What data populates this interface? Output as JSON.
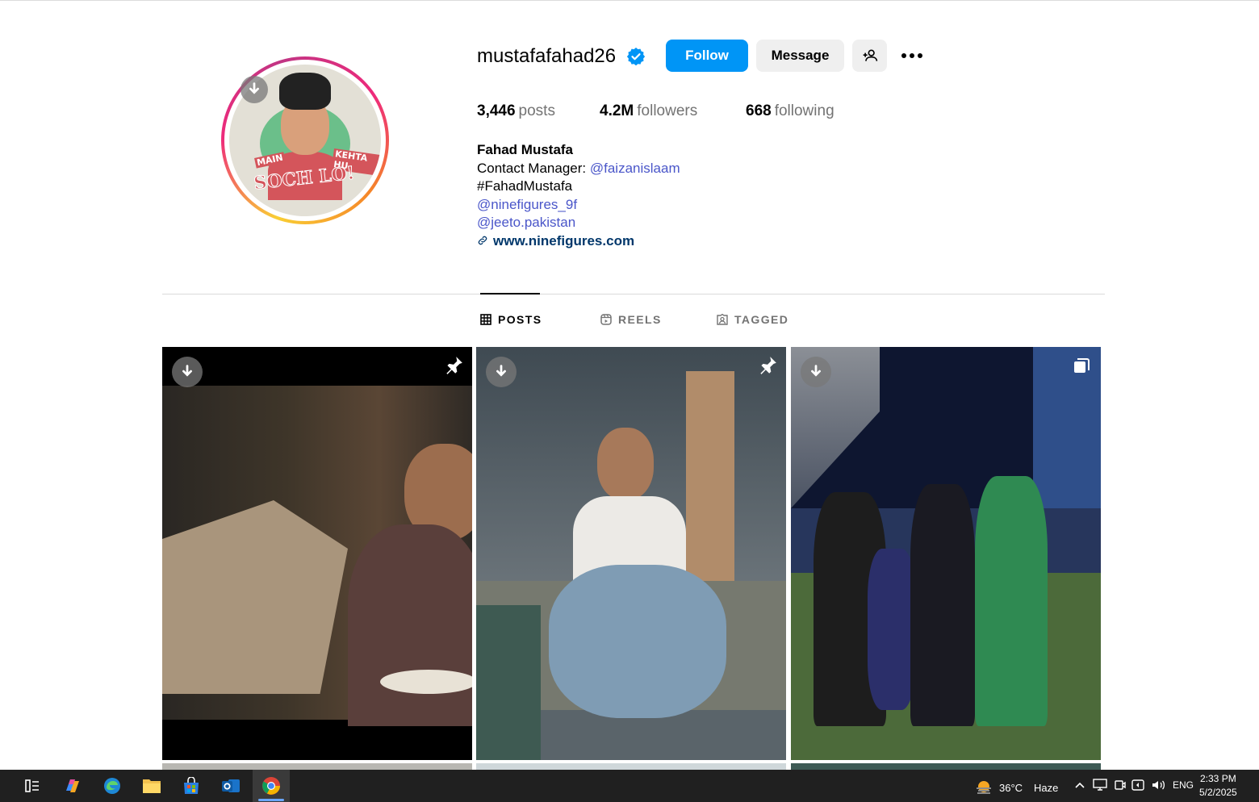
{
  "profile": {
    "username": "mustafafahad26",
    "verified_icon": "verified-badge-icon",
    "buttons": {
      "follow": "Follow",
      "message": "Message"
    },
    "stats": {
      "posts_count": "3,446",
      "posts_label": "posts",
      "followers_count": "4.2M",
      "followers_label": "followers",
      "following_count": "668",
      "following_label": "following"
    },
    "bio": {
      "name": "Fahad Mustafa",
      "contact_prefix": "Contact Manager: ",
      "contact_handle": "@faizanislaam",
      "hashtag": "#FahadMustafa",
      "link1": "@ninefigures_9f",
      "link2": "@jeeto.pakistan",
      "website": "www.ninefigures.com"
    },
    "avatar_caption_main": "SOCH LO!",
    "avatar_caption_left": "MAIN",
    "avatar_caption_right": "KEHTA HU"
  },
  "tabs": [
    {
      "label": "POSTS",
      "icon": "grid-icon",
      "active": true
    },
    {
      "label": "REELS",
      "icon": "reels-icon",
      "active": false
    },
    {
      "label": "TAGGED",
      "icon": "tagged-icon",
      "active": false
    }
  ],
  "taskbar": {
    "weather_temp": "36°C",
    "weather_desc": "Haze",
    "language": "ENG",
    "time": "2:33 PM",
    "date": "5/2/2025"
  },
  "colors": {
    "accent": "#0095f6",
    "link": "#4a56c9",
    "website": "#00376b"
  }
}
